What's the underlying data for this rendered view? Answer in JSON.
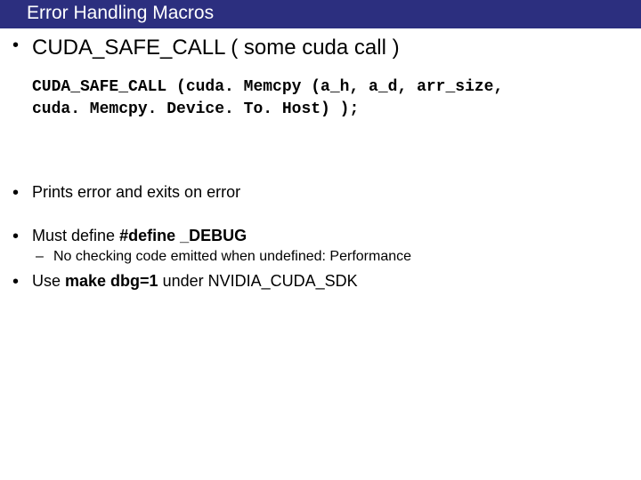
{
  "title": "Error Handling Macros",
  "bullets": {
    "b1": "CUDA_SAFE_CALL ( some cuda call )",
    "code_line1": "CUDA_SAFE_CALL (cuda. Memcpy (a_h, a_d, arr_size,",
    "code_line2": "cuda. Memcpy. Device. To. Host) );",
    "b2": "Prints error and exits on error",
    "b3_pre": "Must define ",
    "b3_bold": "#define _DEBUG",
    "b3_sub": "No checking code emitted when undefined: Performance",
    "b4_pre": "Use ",
    "b4_bold": "make dbg=1",
    "b4_post": " under NVIDIA_CUDA_SDK"
  }
}
